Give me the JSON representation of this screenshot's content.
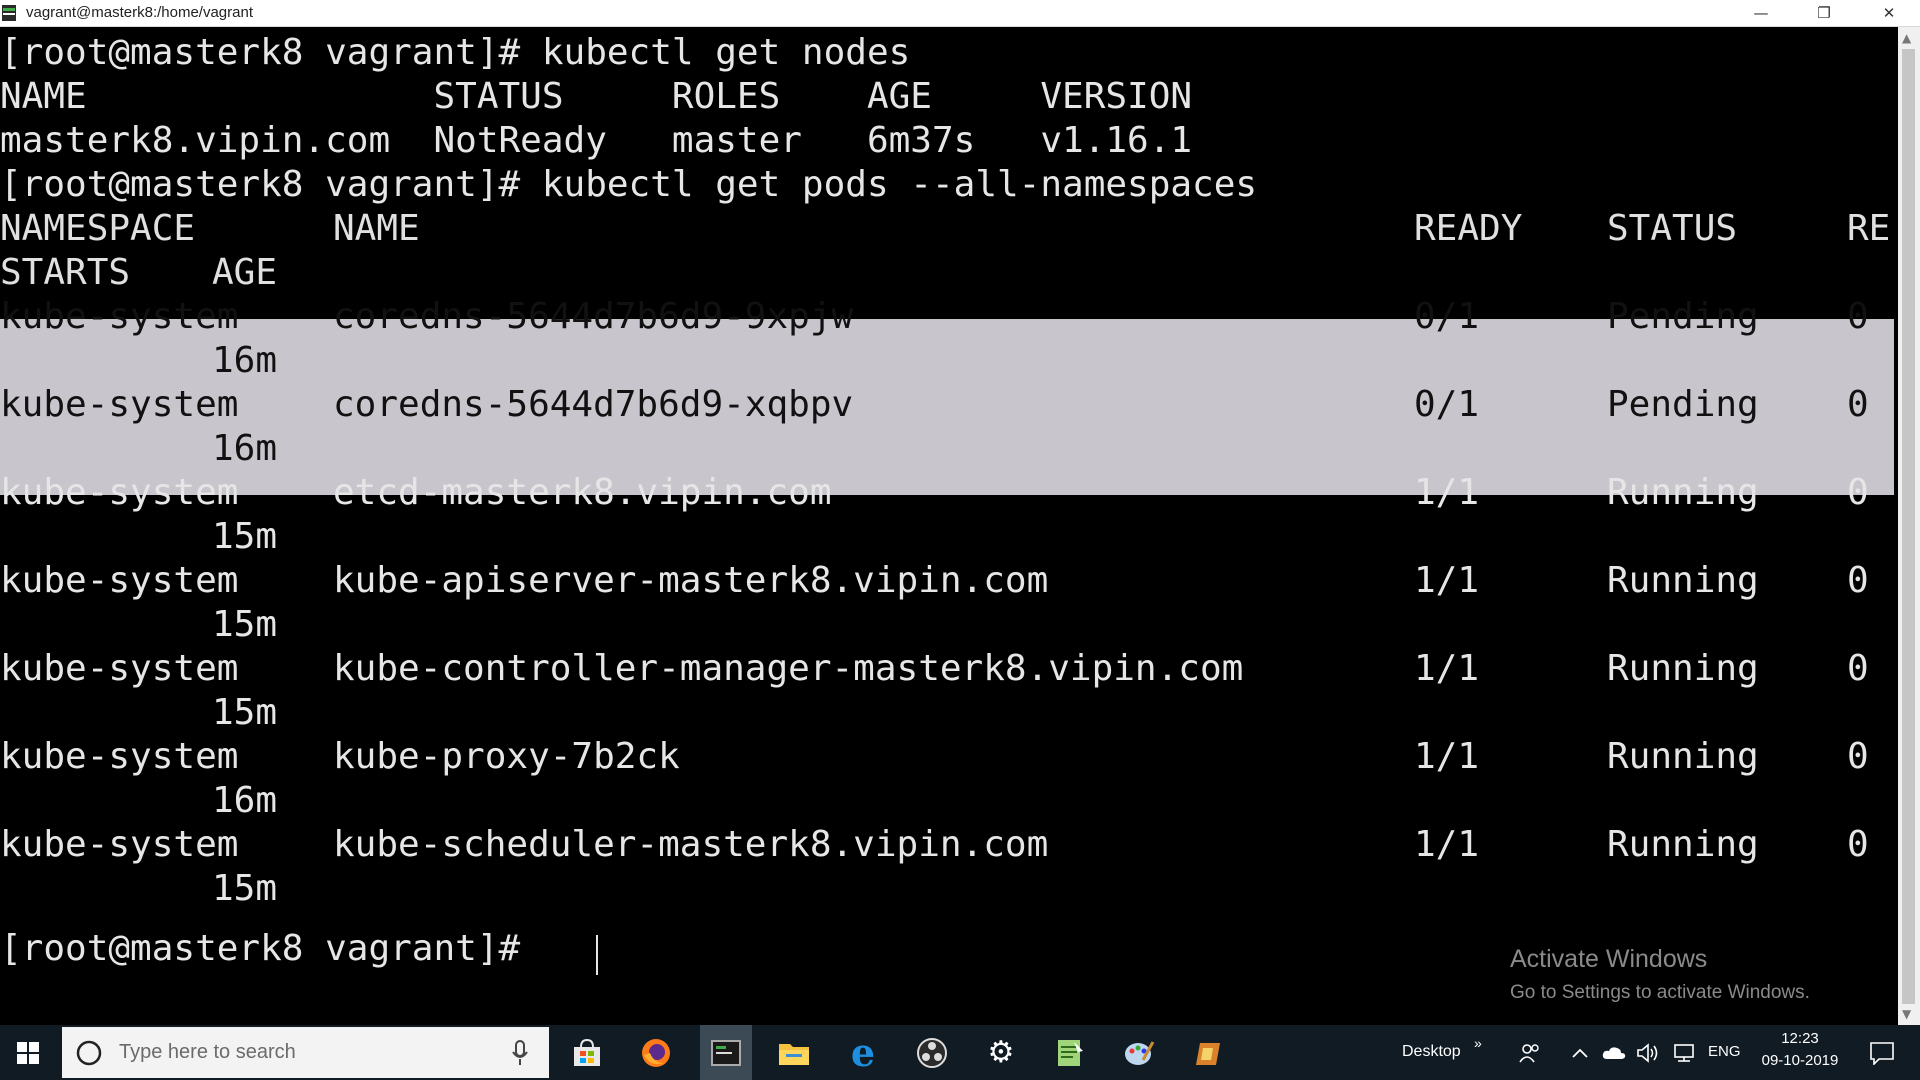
{
  "window": {
    "title": "vagrant@masterk8:/home/vagrant",
    "minimize_glyph": "—",
    "maximize_glyph": "❐",
    "close_glyph": "✕"
  },
  "terminal": {
    "lines": [
      "[root@masterk8 vagrant]# kubectl get nodes",
      "NAME                STATUS     ROLES    AGE     VERSION",
      "masterk8.vipin.com  NotReady   master   6m37s   v1.16.1",
      "[root@masterk8 vagrant]# kubectl get pods --all-namespaces"
    ],
    "pods_header": {
      "namespace": "NAMESPACE",
      "name": "NAME",
      "ready": "READY",
      "status": "STATUS",
      "restarts_head": "RE",
      "restarts_tail": "STARTS",
      "age": "AGE"
    },
    "pods": [
      {
        "namespace": "kube-system",
        "name": "coredns-5644d7b6d9-9xpjw",
        "ready": "0/1",
        "status": "Pending",
        "restarts": "0",
        "age": "16m"
      },
      {
        "namespace": "kube-system",
        "name": "coredns-5644d7b6d9-xqbpv",
        "ready": "0/1",
        "status": "Pending",
        "restarts": "0",
        "age": "16m"
      },
      {
        "namespace": "kube-system",
        "name": "etcd-masterk8.vipin.com",
        "ready": "1/1",
        "status": "Running",
        "restarts": "0",
        "age": "15m"
      },
      {
        "namespace": "kube-system",
        "name": "kube-apiserver-masterk8.vipin.com",
        "ready": "1/1",
        "status": "Running",
        "restarts": "0",
        "age": "15m"
      },
      {
        "namespace": "kube-system",
        "name": "kube-controller-manager-masterk8.vipin.com",
        "ready": "1/1",
        "status": "Running",
        "restarts": "0",
        "age": "15m"
      },
      {
        "namespace": "kube-system",
        "name": "kube-proxy-7b2ck",
        "ready": "1/1",
        "status": "Running",
        "restarts": "0",
        "age": "16m"
      },
      {
        "namespace": "kube-system",
        "name": "kube-scheduler-masterk8.vipin.com",
        "ready": "1/1",
        "status": "Running",
        "restarts": "0",
        "age": "15m"
      }
    ],
    "prompt": "[root@masterk8 vagrant]# "
  },
  "watermark": {
    "heading": "Activate Windows",
    "subtext": "Go to Settings to activate Windows."
  },
  "taskbar": {
    "search_placeholder": "Type here to search",
    "desktop_label": "Desktop",
    "desktop_chevron": "»",
    "language": "ENG",
    "time": "12:23",
    "date": "09-10-2019"
  },
  "colors": {
    "terminal_bg": "#000000",
    "terminal_fg": "#e6e6e6",
    "selection": "#c9c5cd",
    "taskbar_bg": "#101b24"
  }
}
